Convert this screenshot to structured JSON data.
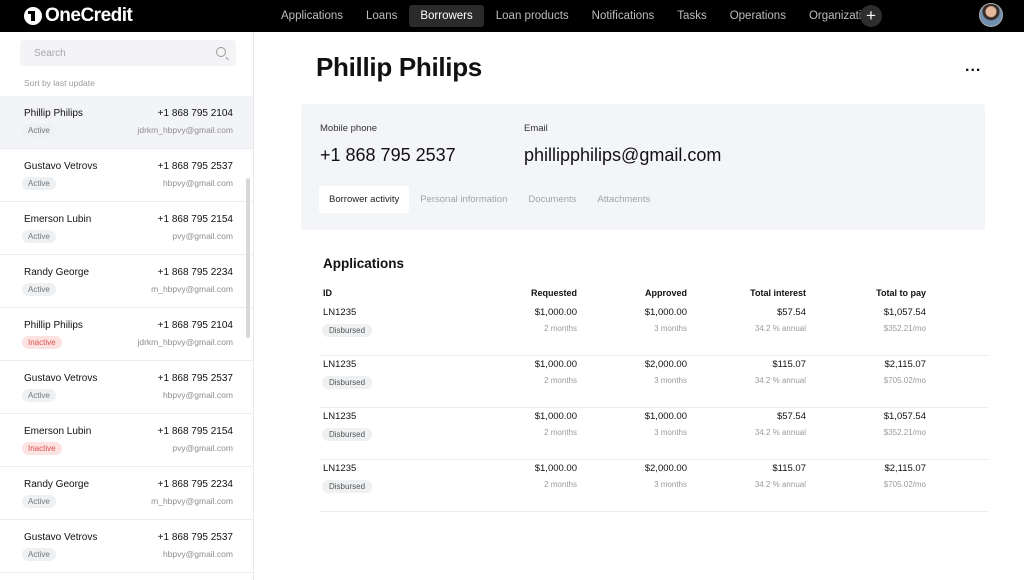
{
  "app": {
    "name": "OneCredit"
  },
  "nav": {
    "items": [
      {
        "label": "Applications",
        "active": false
      },
      {
        "label": "Loans",
        "active": false
      },
      {
        "label": "Borrowers",
        "active": true
      },
      {
        "label": "Loan products",
        "active": false
      },
      {
        "label": "Notifications",
        "active": false
      },
      {
        "label": "Tasks",
        "active": false
      },
      {
        "label": "Operations",
        "active": false
      },
      {
        "label": "Organization",
        "active": false
      }
    ],
    "plus_label": "+"
  },
  "sidebar": {
    "search_placeholder": "Search",
    "sort_label": "Sort by last update",
    "borrowers": [
      {
        "name": "Phillip Philips",
        "phone": "+1 868 795 2104",
        "status": "Active",
        "email": "jdrkm_hbpvy@gmail.com",
        "selected": true
      },
      {
        "name": "Gustavo Vetrovs",
        "phone": "+1 868 795 2537",
        "status": "Active",
        "email": "hbpvy@gmail.com",
        "selected": false
      },
      {
        "name": "Emerson Lubin",
        "phone": "+1 868 795 2154",
        "status": "Active",
        "email": "pvy@gmail.com",
        "selected": false
      },
      {
        "name": "Randy George",
        "phone": "+1 868 795 2234",
        "status": "Active",
        "email": "m_hbpvy@gmail.com",
        "selected": false
      },
      {
        "name": "Phillip Philips",
        "phone": "+1 868 795 2104",
        "status": "Inactive",
        "email": "jdrkm_hbpvy@gmail.com",
        "selected": false
      },
      {
        "name": "Gustavo Vetrovs",
        "phone": "+1 868 795 2537",
        "status": "Active",
        "email": "hbpvy@gmail.com",
        "selected": false
      },
      {
        "name": "Emerson Lubin",
        "phone": "+1 868 795 2154",
        "status": "Inactive",
        "email": "pvy@gmail.com",
        "selected": false
      },
      {
        "name": "Randy George",
        "phone": "+1 868 795 2234",
        "status": "Active",
        "email": "m_hbpvy@gmail.com",
        "selected": false
      },
      {
        "name": "Gustavo Vetrovs",
        "phone": "+1 868 795 2537",
        "status": "Active",
        "email": "hbpvy@gmail.com",
        "selected": false
      }
    ]
  },
  "main": {
    "title": "Phillip Philips",
    "more_label": "...",
    "mobile_label": "Mobile phone",
    "mobile_value": "+1 868 795 2537",
    "email_label": "Email",
    "email_value": "phillipphilips@gmail.com",
    "tabs": [
      {
        "label": "Borrower activity",
        "active": true
      },
      {
        "label": "Personal information",
        "active": false
      },
      {
        "label": "Documents",
        "active": false
      },
      {
        "label": "Attachments",
        "active": false
      }
    ],
    "applications_title": "Applications",
    "columns": [
      "ID",
      "Requested",
      "Approved",
      "Total interest",
      "Total to pay"
    ],
    "applications": [
      {
        "id": "LN1235",
        "status": "Disbursed",
        "requested": "$1,000.00",
        "requested_term": "2 months",
        "approved": "$1,000.00",
        "approved_term": "3 months",
        "interest": "$57.54",
        "interest_rate": "34.2 % annual",
        "total": "$1,057.54",
        "monthly": "$352.21/mo"
      },
      {
        "id": "LN1235",
        "status": "Disbursed",
        "requested": "$1,000.00",
        "requested_term": "2 months",
        "approved": "$2,000.00",
        "approved_term": "3 months",
        "interest": "$115.07",
        "interest_rate": "34.2 % annual",
        "total": "$2,115.07",
        "monthly": "$705.02/mo"
      },
      {
        "id": "LN1235",
        "status": "Disbursed",
        "requested": "$1,000.00",
        "requested_term": "2 months",
        "approved": "$1,000.00",
        "approved_term": "3 months",
        "interest": "$57.54",
        "interest_rate": "34.2 % annual",
        "total": "$1,057.54",
        "monthly": "$352.21/mo"
      },
      {
        "id": "LN1235",
        "status": "Disbursed",
        "requested": "$1,000.00",
        "requested_term": "2 months",
        "approved": "$2,000.00",
        "approved_term": "3 months",
        "interest": "$115.07",
        "interest_rate": "34.2 % annual",
        "total": "$2,115.07",
        "monthly": "$705.02/mo"
      }
    ]
  }
}
